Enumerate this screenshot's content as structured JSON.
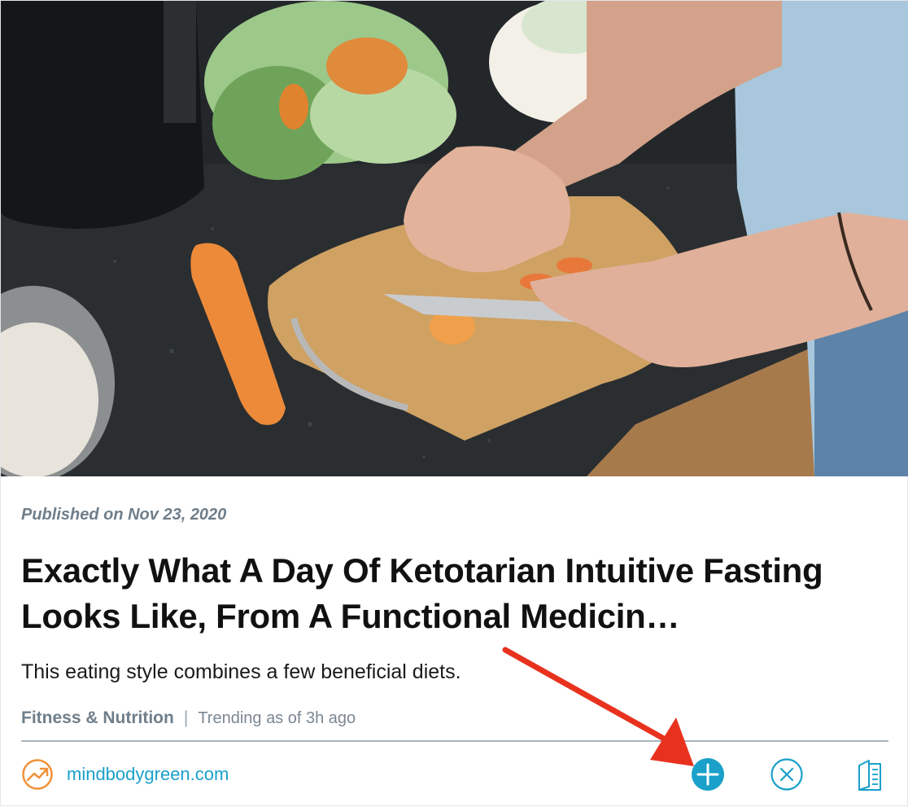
{
  "article": {
    "published": "Published on Nov 23, 2020",
    "headline": "Exactly What A Day Of Ketotarian Intuitive Fasting Looks Like, From A Functional Medicin…",
    "subtitle": "This eating style combines a few beneficial diets.",
    "category": "Fitness & Nutrition",
    "separator": "|",
    "trending": "Trending as of 3h ago"
  },
  "source": {
    "name": "mindbodygreen.com",
    "icon": "trending-up-icon"
  },
  "actions": {
    "add_icon": "plus-circle-icon",
    "dismiss_icon": "close-circle-icon",
    "read_icon": "reader-icon"
  },
  "colors": {
    "accent_blue": "#1aa0c9",
    "trend_orange": "#f0923a",
    "annotation_red": "#e8321e",
    "meta_gray": "#6f7e8a"
  }
}
